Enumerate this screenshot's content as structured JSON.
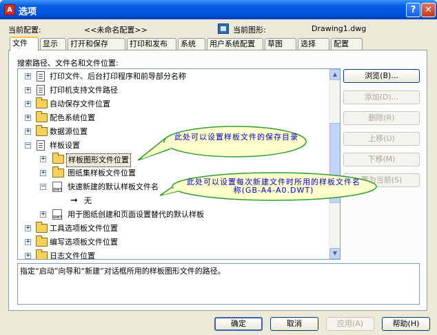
{
  "window": {
    "title": "选项",
    "help_glyph": "?",
    "close_glyph": "✕",
    "icon_text": "A"
  },
  "info": {
    "current_profile_label": "当前配置:",
    "current_profile_value": "<<未命名配置>>",
    "current_drawing_label": "当前图形:",
    "current_drawing_value": "Drawing1.dwg"
  },
  "tabs": [
    "文件",
    "显示",
    "打开和保存",
    "打印和发布",
    "系统",
    "用户系统配置",
    "草图",
    "选择",
    "配置"
  ],
  "active_tab": "文件",
  "section_label": "搜索路径、文件名和文件位置:",
  "tree": [
    {
      "label": "打印文件、后台打印程序和前导部分名称",
      "icon": "document-icon",
      "expander": "+"
    },
    {
      "label": "打印机支持文件路径",
      "icon": "document-icon",
      "expander": "+"
    },
    {
      "label": "自动保存文件位置",
      "icon": "folder-icon",
      "expander": "+"
    },
    {
      "label": "配色系统位置",
      "icon": "folder-icon",
      "expander": "+"
    },
    {
      "label": "数据源位置",
      "icon": "folder-icon",
      "expander": "+"
    },
    {
      "label": "样板设置",
      "icon": "document-icon",
      "expander": "−"
    },
    {
      "label": "样板图形文件位置",
      "icon": "folder-icon",
      "expander": "+",
      "selected": true
    },
    {
      "label": "图纸集样板文件位置",
      "icon": "folder-icon",
      "expander": "+"
    },
    {
      "label": "快速新建的默认样板文件名",
      "icon": "dwt-icon",
      "expander": "−"
    },
    {
      "label": "无",
      "icon": "arrow-icon",
      "expander": ""
    },
    {
      "label": "用于图纸创建和页面设置替代的默认样板",
      "icon": "dwt-icon",
      "expander": "+"
    },
    {
      "label": "工具选项板文件位置",
      "icon": "folder-icon",
      "expander": "+"
    },
    {
      "label": "编写选项板文件位置",
      "icon": "folder-icon",
      "expander": "+"
    },
    {
      "label": "日志文件位置",
      "icon": "folder-icon",
      "expander": "+"
    }
  ],
  "scroll": {
    "up": "▲",
    "down": "▼"
  },
  "side_buttons": [
    {
      "label": "浏览(B)...",
      "enabled": true
    },
    {
      "label": "添加(D)...",
      "enabled": false
    },
    {
      "label": "删除(R)",
      "enabled": false
    },
    {
      "label": "上移(U)",
      "enabled": false
    },
    {
      "label": "下移(M)",
      "enabled": false
    },
    {
      "label": "置为当前(S)",
      "enabled": false
    }
  ],
  "description": "指定“启动”向导和“新建”对话框所用的样板图形文件的路径。",
  "annotations": {
    "callout1": "此处可以设置样板文件的保存目录",
    "callout2": "此处可以设置每次新建文件时所用的样板文件名称(GB-A4-A0.DWT)"
  },
  "footer": {
    "ok": "确定",
    "cancel": "取消",
    "apply": "应用(A)",
    "help": "帮助(H)"
  },
  "colors": {
    "callout_fill": "#ffffcc",
    "callout_stroke": "#2e9e2e",
    "callout_text": "#0000cc"
  }
}
